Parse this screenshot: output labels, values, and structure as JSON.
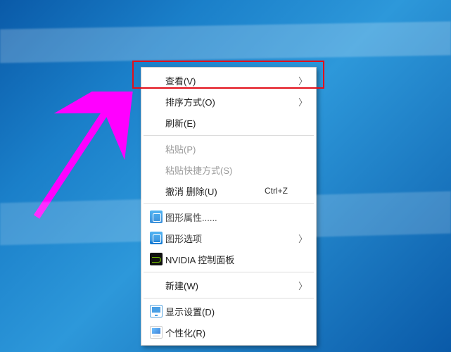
{
  "menu": {
    "view": {
      "label": "查看(V)"
    },
    "sort": {
      "label": "排序方式(O)"
    },
    "refresh": {
      "label": "刷新(E)"
    },
    "paste": {
      "label": "粘贴(P)"
    },
    "pasteShortcut": {
      "label": "粘贴快捷方式(S)"
    },
    "undo": {
      "label": "撤消 删除(U)",
      "shortcut": "Ctrl+Z"
    },
    "gfxProps": {
      "label": "图形属性......"
    },
    "gfxOptions": {
      "label": "图形选项"
    },
    "nvidia": {
      "label": "NVIDIA 控制面板"
    },
    "new": {
      "label": "新建(W)"
    },
    "display": {
      "label": "显示设置(D)"
    },
    "personalize": {
      "label": "个性化(R)"
    }
  },
  "annotation": {
    "highlight_color": "#e20f1a",
    "arrow_color": "#ff00ff"
  }
}
